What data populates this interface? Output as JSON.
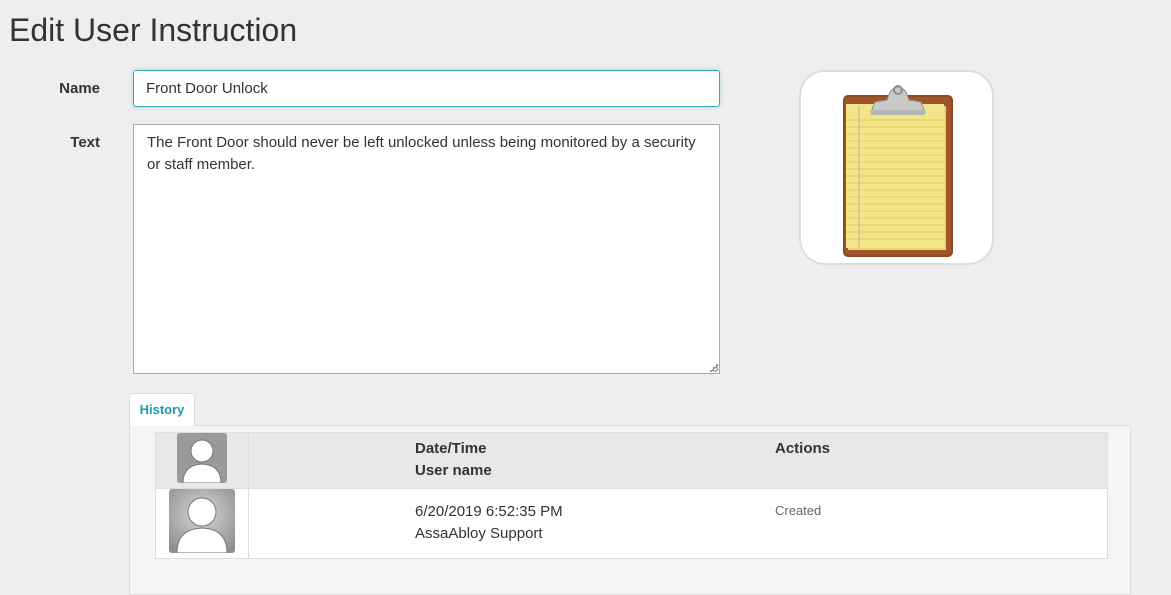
{
  "page": {
    "title": "Edit User Instruction"
  },
  "form": {
    "name_label": "Name",
    "name_value": "Front Door Unlock",
    "text_label": "Text",
    "text_value": "The Front Door should never be left unlocked unless being monitored by a security or staff member."
  },
  "instruction_icon": "clipboard-icon",
  "history": {
    "tab_label": "History",
    "columns": {
      "datetime": "Date/Time",
      "username": "User name",
      "actions": "Actions"
    },
    "rows": [
      {
        "datetime": "6/20/2019 6:52:35 PM",
        "username": "AssaAbloy Support",
        "action": "Created"
      }
    ]
  },
  "colors": {
    "accent": "#1a9bb0",
    "background": "#eeeeee"
  }
}
